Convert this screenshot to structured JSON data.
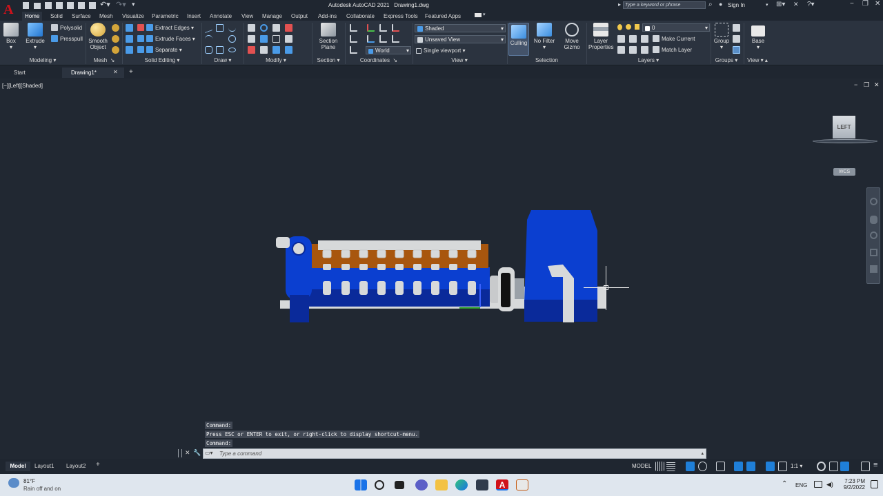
{
  "app": {
    "title": "Autodesk AutoCAD 2021",
    "file": "Drawing1.dwg",
    "logo_letter": "A",
    "search_placeholder": "Type a keyword or phrase",
    "sign_in": "Sign In"
  },
  "ribbon_tabs": [
    "Home",
    "Solid",
    "Surface",
    "Mesh",
    "Visualize",
    "Parametric",
    "Insert",
    "Annotate",
    "View",
    "Manage",
    "Output",
    "Add-ins",
    "Collaborate",
    "Express Tools",
    "Featured Apps"
  ],
  "ribbon": {
    "box": "Box",
    "extrude": "Extrude",
    "polysolid": "Polysolid",
    "presspull": "Presspull",
    "smooth": "Smooth Object",
    "extract_edges": "Extract Edges",
    "extrude_faces": "Extrude Faces",
    "separate": "Separate",
    "section_plane": "Section Plane",
    "world": "World",
    "visual_style": "Shaded",
    "named_view": "Unsaved View",
    "viewport": "Single viewport",
    "culling": "Culling",
    "no_filter": "No Filter",
    "move_gizmo": "Move Gizmo",
    "layer_properties": "Layer Properties",
    "layer_value": "0",
    "make_current": "Make Current",
    "match_layer": "Match Layer",
    "group": "Group",
    "base": "Base"
  },
  "groups": [
    "Modeling",
    "Mesh",
    "Solid Editing",
    "Draw",
    "Modify",
    "Section",
    "Coordinates",
    "View",
    "Selection",
    "Layers",
    "Groups",
    "View"
  ],
  "doc_tabs": {
    "start": "Start",
    "drawing": "Drawing1*"
  },
  "viewport": {
    "label": "[−][Left][Shaded]",
    "viewcube": "LEFT",
    "wcs": "WCS"
  },
  "command": {
    "history": [
      "Command:",
      "Press ESC or ENTER to exit, or right-click to display shortcut-menu.",
      "Command:"
    ],
    "placeholder": "Type a command"
  },
  "layouts": [
    "Model",
    "Layout1",
    "Layout2"
  ],
  "status": {
    "model": "MODEL",
    "scale": "1:1"
  },
  "taskbar": {
    "temp": "81°F",
    "weather": "Rain off and on",
    "lang": "ENG",
    "time": "7:23 PM",
    "date": "9/2/2022"
  },
  "colors": {
    "accent": "#1f7fd8",
    "engine_blue": "#0b3fd0",
    "engine_dark": "#0a2a9a",
    "rocker_orange": "#a8560e",
    "base_grey": "#d7d9da",
    "viewport_bg": "#212832",
    "logo_red": "#d0121b"
  }
}
